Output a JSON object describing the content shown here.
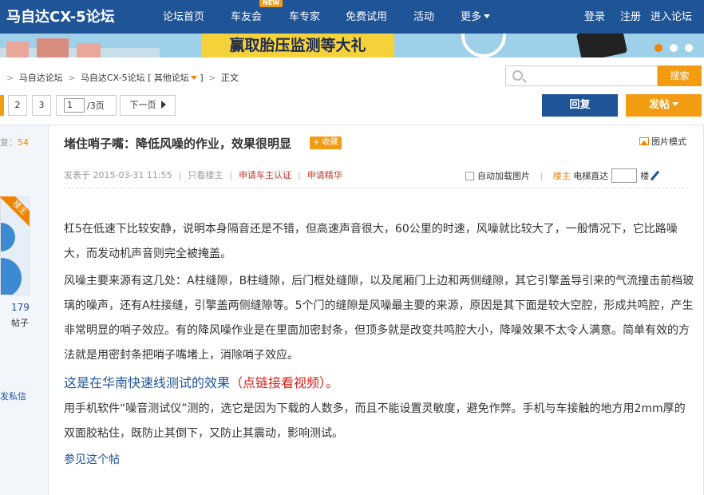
{
  "header": {
    "site_title": "马自达CX-5论坛",
    "nav": [
      "论坛首页",
      "车友会",
      "车专家",
      "免费试用",
      "活动",
      "更多"
    ],
    "new_badge": "NEW",
    "user_links": [
      "登录",
      "注册",
      "进入论坛"
    ]
  },
  "banner": {
    "text": "赢取胎压监测等大礼"
  },
  "breadcrumb": {
    "items": [
      "马自达论坛",
      "马自达CX-5论坛",
      "[ 其他论坛",
      "]",
      "正文"
    ],
    "prefix": ">"
  },
  "search": {
    "button_label": "搜索",
    "placeholder": ""
  },
  "pagination": {
    "pages": [
      "2",
      "3"
    ],
    "current_page": "1",
    "total": "/3页",
    "next_label": "下一页"
  },
  "actions": {
    "reply_label": "回复",
    "post_label": "发帖"
  },
  "sidebar": {
    "reply_label": "复：",
    "reply_count": "54",
    "owner_ribbon": "楼主",
    "threads_count": "179",
    "threads_label": "帖子",
    "pm_label": "发私信"
  },
  "post": {
    "title": "堵住哨子嘴：降低风噪的作业，效果很明显",
    "fav_label": "+ 收藏",
    "image_mode_label": "图片模式",
    "posted_at": "发表于 2015-03-31 11:55",
    "only_owner": "只看楼主",
    "apply_cert": "申请车主认证",
    "apply_featured": "申请精华",
    "auto_load_images": "自动加载图片",
    "floor_owner": "楼主",
    "elevator_label": "电梯直达",
    "floor_suffix": "楼",
    "paragraphs": [
      "杠5在低速下比较安静，说明本身隔音还是不错，但高速声音很大，60公里的时速，风噪就比较大了，一般情况下，它比路噪大，而发动机声音则完全被掩盖。",
      "风噪主要来源有这几处：A柱缝隙，B柱缝隙，后门框处缝隙，以及尾厢门上边和两侧缝隙，其它引擎盖导引来的气流撞击前档玻璃的噪声，还有A柱接缝，引擎盖两侧缝隙等。5个门的缝隙是风噪最主要的来源，原因是其下面是较大空腔，形成共鸣腔，产生非常明显的哨子效应。有的降风噪作业是在里面加密封条，但顶多就是改变共鸣腔大小，降噪效果不太令人满意。简单有效的方法就是用密封条把哨子嘴堵上，消除哨子效应。"
    ],
    "video_text": "这是在华南快速线测试的效果",
    "video_link": "（点链接看视频）。",
    "paragraph_3": "用手机软件“噪音测试仪”测的，选它是因为下载的人数多，而且不能设置灵敏度，避免作弊。手机与车接触的地方用2mm厚的双面胶粘住，既防止其倒下，又防止其震动，影响测试。",
    "see_post": "参见这个帖"
  },
  "colors": {
    "brand_blue": "#1f5497",
    "accent_orange": "#f39c12",
    "link_red": "#d9221d"
  }
}
